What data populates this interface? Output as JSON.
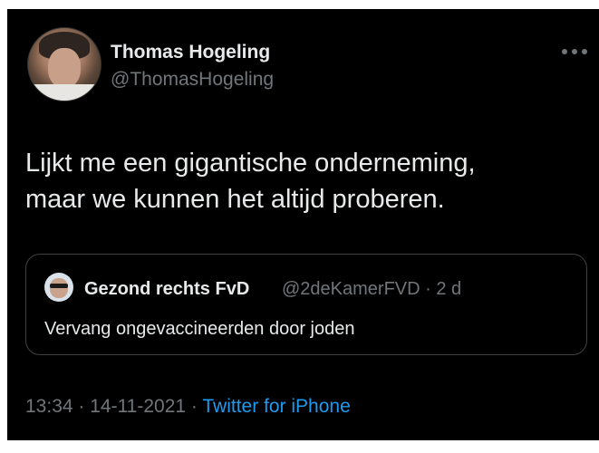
{
  "author": {
    "display_name": "Thomas Hogeling",
    "handle": "@ThomasHogeling"
  },
  "tweet": {
    "lines": [
      "Lijkt me een gigantische onderneming,",
      "maar we kunnen het altijd proberen."
    ]
  },
  "quoted_tweet": {
    "display_name": "Gezond rechts FvD",
    "handle_and_age": "@2deKamerFVD · 2 d",
    "text": "Vervang ongevaccineerden door joden"
  },
  "meta": {
    "timestamp": "13:34 · 14-11-2021 · ",
    "source": "Twitter for iPhone"
  },
  "icons": {
    "more": "more-horizontal-icon",
    "avatar": "avatar",
    "quote_avatar": "avatar"
  },
  "colors": {
    "background": "#000000",
    "primary_text": "#e7e9ea",
    "secondary_text": "#71767b",
    "link": "#1d9bf0",
    "border": "#3e4144"
  }
}
